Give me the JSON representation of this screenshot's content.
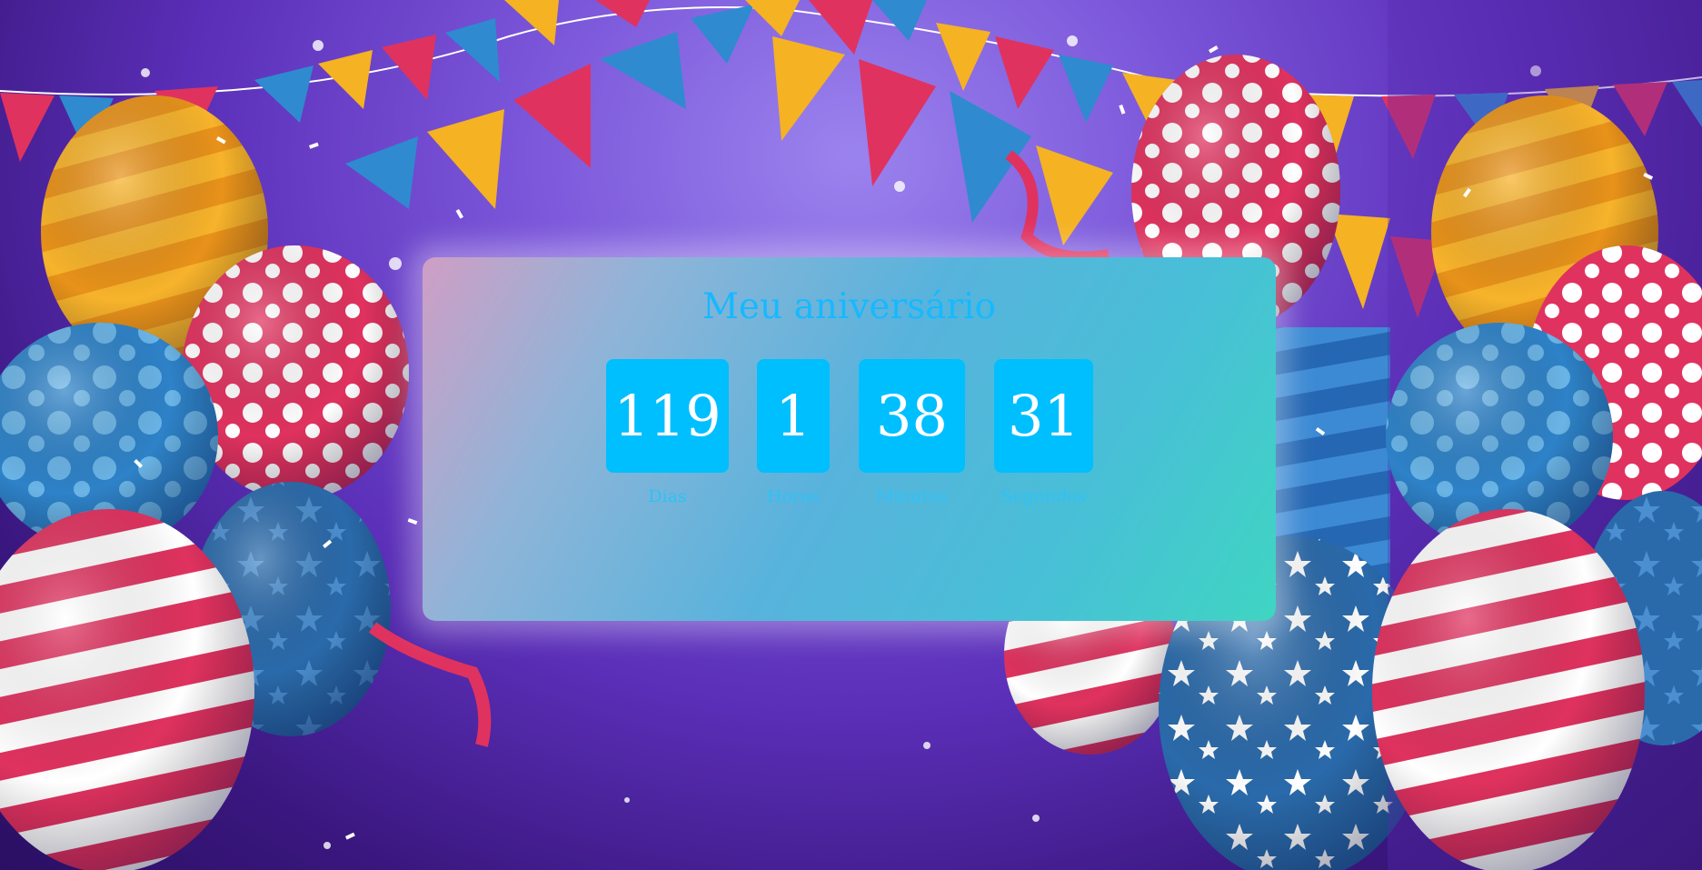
{
  "page": {
    "title": "Meu aniversário"
  },
  "countdown": [
    {
      "value": "119",
      "label": "Dias"
    },
    {
      "value": "1",
      "label": "Horas"
    },
    {
      "value": "38",
      "label": "Minutos"
    },
    {
      "value": "31",
      "label": "Segundos"
    }
  ],
  "colors": {
    "title": "#16b9ff",
    "box": "#00bfff",
    "label": "#2fc1f7"
  },
  "background": {
    "description_icon": "party-balloons-background"
  }
}
